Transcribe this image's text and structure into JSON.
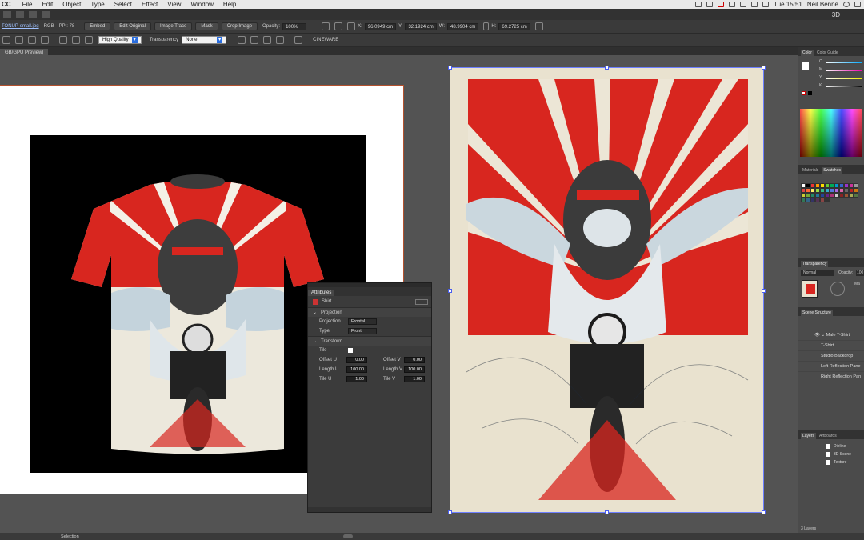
{
  "menubar": {
    "app": "CC",
    "items": [
      "File",
      "Edit",
      "Object",
      "Type",
      "Select",
      "Effect",
      "View",
      "Window",
      "Help"
    ],
    "clock": "Tue 15:51",
    "user": "Neil Benne"
  },
  "appbar": {
    "workspace": "3D"
  },
  "control": {
    "filename": "TONUP-small.jpg",
    "color_mode": "RGB",
    "ppi_label": "PPI: 78",
    "embed": "Embed",
    "edit_original": "Edit Original",
    "image_trace": "Image Trace",
    "mask": "Mask",
    "crop_image": "Crop Image",
    "opacity_label": "Opacity:",
    "opacity_value": "100%",
    "x_label": "X:",
    "x_value": "96.0949 cm",
    "y_label": "Y:",
    "y_value": "32.1924 cm",
    "w_label": "W:",
    "w_value": "48.9904 cm",
    "h_label": "H:",
    "h_value": "69.2725 cm"
  },
  "options": {
    "quality": "High Quality",
    "transparency_label": "Transparency",
    "transparency_value": "None",
    "cineware": "CINEWARE"
  },
  "document": {
    "tab": "GB/GPU Preview)"
  },
  "attributes": {
    "panel_title": "Attributes",
    "object_name": "Shirt",
    "projection_section": "Projection",
    "projection_label": "Projection",
    "projection_value": "Frontal",
    "type_label": "Type",
    "type_value": "Front",
    "transform_section": "Transform",
    "tile_label": "Tile",
    "offset_u_label": "Offset U",
    "offset_u": "0.00",
    "offset_v_label": "Offset V",
    "offset_v": "0.00",
    "length_u_label": "Length U",
    "length_u": "100.00",
    "length_v_label": "Length V",
    "length_v": "100.00",
    "tile_u_label": "Tile U",
    "tile_u": "1.00",
    "tile_v_label": "Tile V",
    "tile_v": "1.00"
  },
  "right": {
    "color_tab": "Color",
    "color_guide_tab": "Color Guide",
    "cmyk": [
      "C",
      "M",
      "Y",
      "K"
    ],
    "materials_tab": "Materials",
    "swatches_tab": "Swatches",
    "transparency_tab": "Transparency",
    "blend_mode": "Normal",
    "opacity_label": "Opacity:",
    "opacity_value": "100",
    "make_mask": "Ma",
    "scene_tab": "Scene Structure",
    "scene": [
      "Male T-Shirt",
      "T-Shirt",
      "Studio Backdrop",
      "Left Reflection Pane",
      "Right Reflection Pan"
    ],
    "layers_tab": "Layers",
    "artboards_tab": "Artboards",
    "layers": [
      "Dieline",
      "3D Scene",
      "Texture"
    ],
    "layers_count": "3 Layers"
  },
  "status": {
    "tool": "Selection"
  },
  "colors": {
    "poster_red": "#d8261f",
    "poster_cream": "#e9e2cf",
    "accent_blue": "#2a6ee0"
  }
}
